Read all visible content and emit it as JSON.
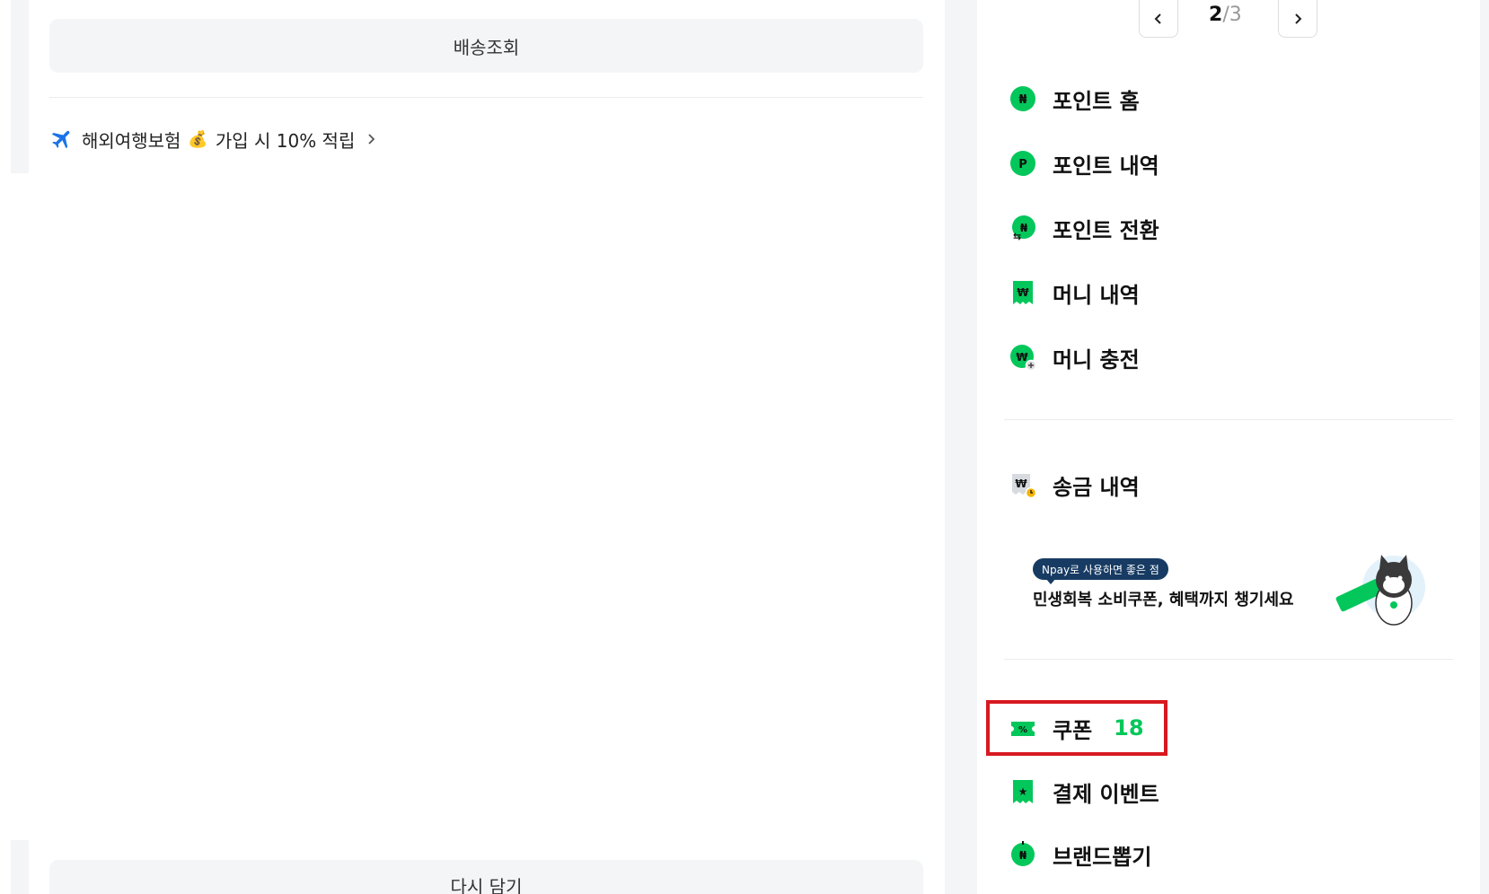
{
  "left": {
    "track_button": "배송조회",
    "promo": {
      "text_before": "해외여행보험",
      "text_after": "가입 시 10% 적립",
      "plane_icon": "airplane-icon",
      "money_icon": "money-bag-icon"
    },
    "recart_button": "다시 담기"
  },
  "pager": {
    "current": "2",
    "separator": "/",
    "total": "3"
  },
  "menu": {
    "group1": [
      {
        "label": "포인트 홈",
        "icon": "npoint-home-icon"
      },
      {
        "label": "포인트 내역",
        "icon": "point-p-icon"
      },
      {
        "label": "포인트 전환",
        "icon": "point-exchange-icon"
      },
      {
        "label": "머니 내역",
        "icon": "money-receipt-icon"
      },
      {
        "label": "머니 충전",
        "icon": "money-charge-icon"
      }
    ],
    "group2": [
      {
        "label": "송금 내역",
        "icon": "transfer-history-icon"
      }
    ],
    "group3": [
      {
        "label": "쿠폰",
        "count": "18",
        "icon": "coupon-icon"
      },
      {
        "label": "결제 이벤트",
        "icon": "payment-event-icon"
      },
      {
        "label": "브랜드뽑기",
        "icon": "brand-draw-icon"
      }
    ]
  },
  "banner": {
    "tag": "Npay로 사용하면 좋은 점",
    "text": "민생회복 소비쿠폰, 혜택까지 챙기세요"
  },
  "colors": {
    "accent": "#03c75a",
    "highlight": "#d71920",
    "tag_bg": "#173b63"
  }
}
